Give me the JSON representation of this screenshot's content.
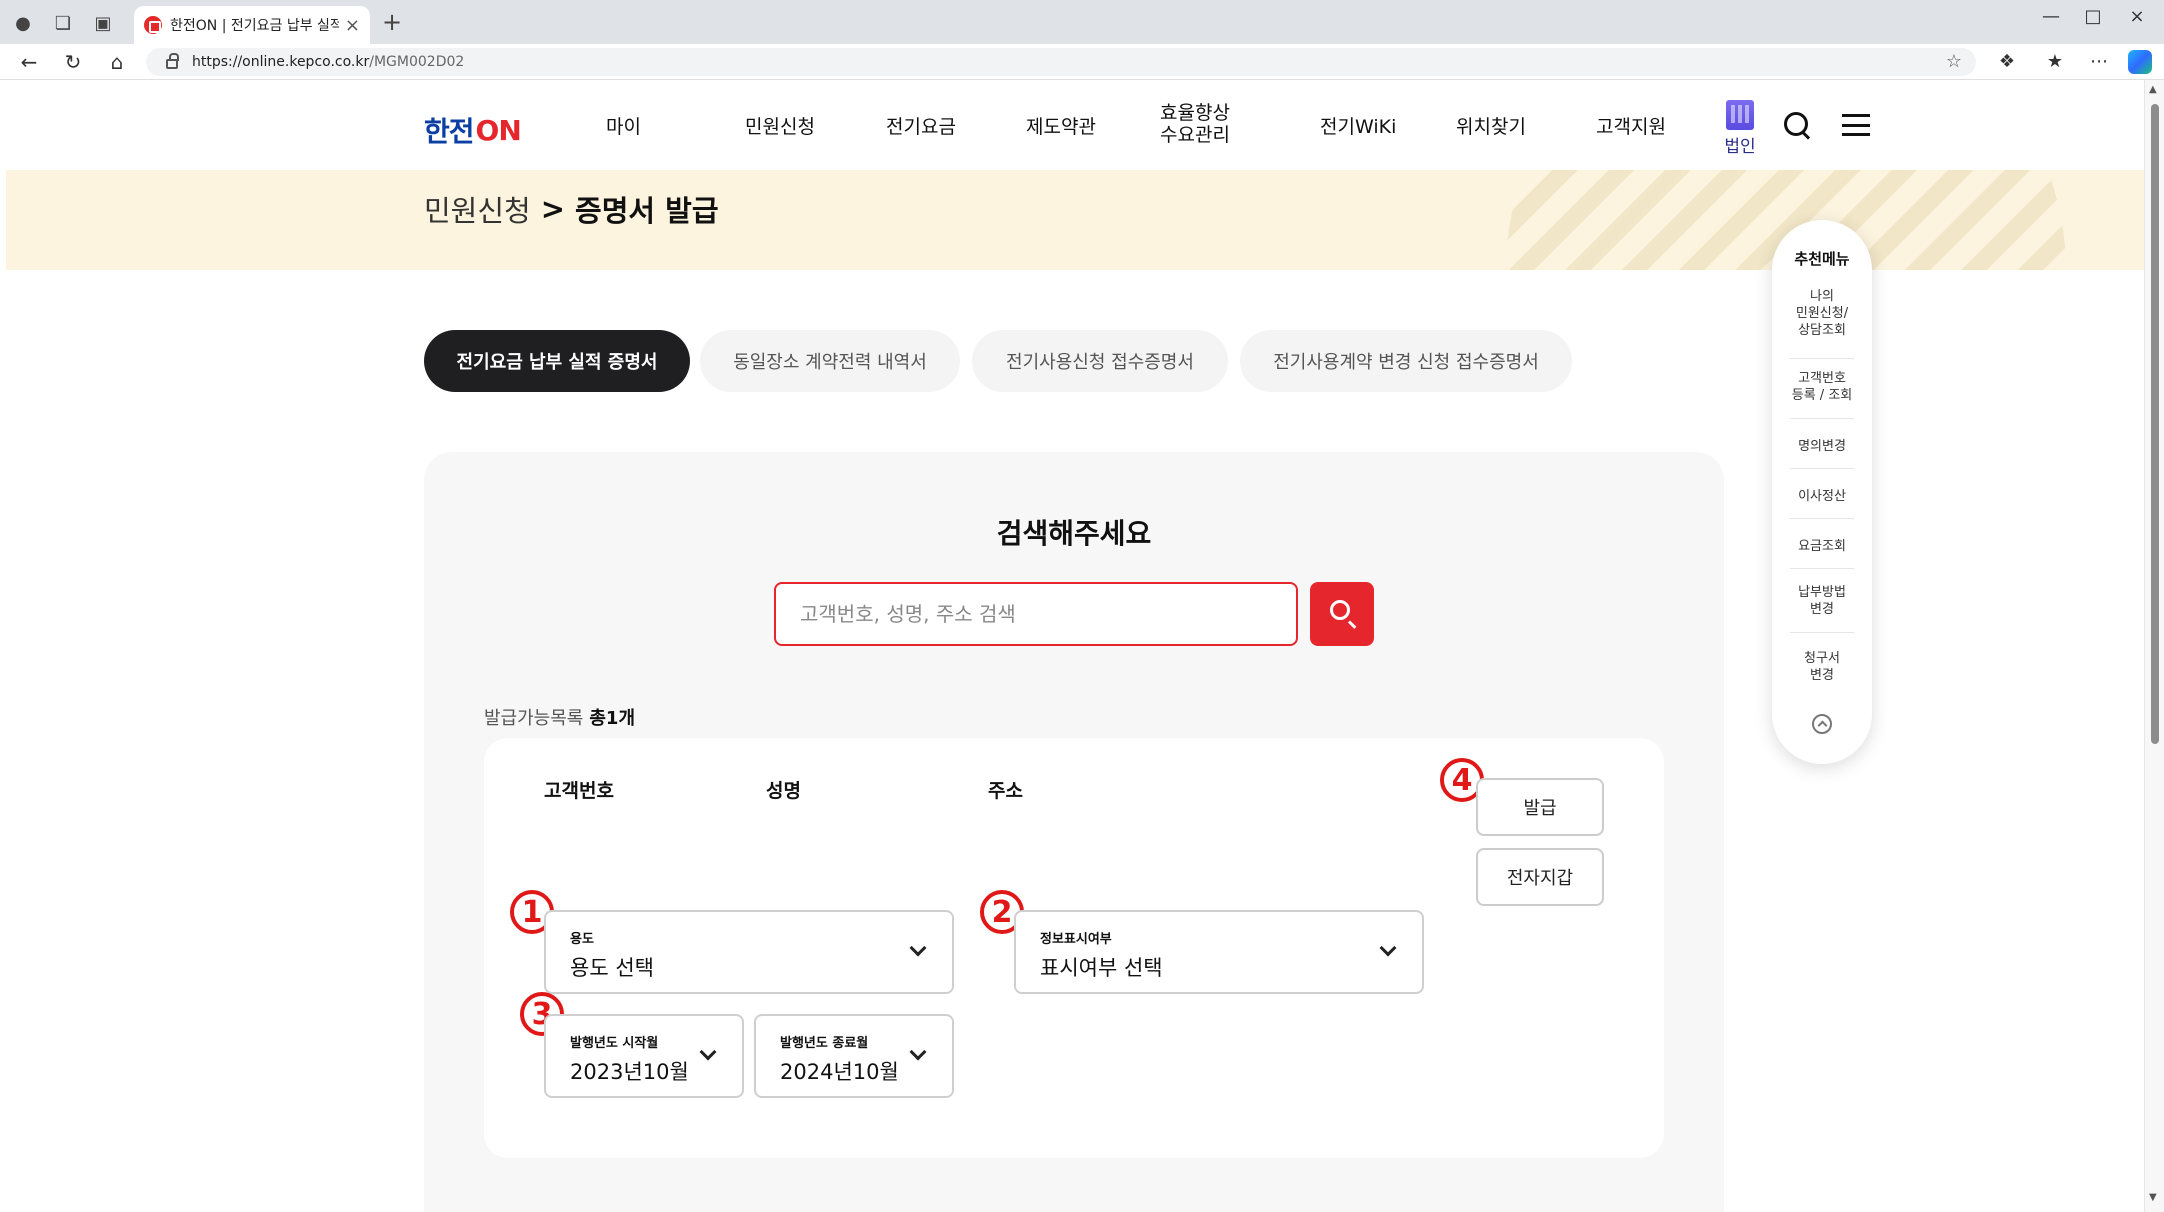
{
  "browser": {
    "tab_title": "한전ON | 전기요금 납부 실적 증명",
    "url_host": "https://online.kepco.co.kr",
    "url_path": "/MGM002D02"
  },
  "header": {
    "logo_han": "한전",
    "logo_on": "ON",
    "nav": [
      "마이",
      "민원신청",
      "전기요금",
      "제도약관",
      "효율향상\n수요관리",
      "전기WiKi",
      "위치찾기",
      "고객지원"
    ],
    "nav_efficiency_line1": "효율향상",
    "nav_efficiency_line2": "수요관리",
    "corp_label": "법인"
  },
  "breadcrumb": {
    "parent": "민원신청",
    "separator": ">",
    "current": "증명서 발급"
  },
  "tabs": [
    {
      "label": "전기요금 납부 실적 증명서",
      "active": true
    },
    {
      "label": "동일장소 계약전력 내역서",
      "active": false
    },
    {
      "label": "전기사용신청 접수증명서",
      "active": false
    },
    {
      "label": "전기사용계약 변경 신청 접수증명서",
      "active": false
    }
  ],
  "search": {
    "title": "검색해주세요",
    "placeholder": "고객번호, 성명, 주소 검색"
  },
  "list": {
    "label": "발급가능목록",
    "count": "총1개",
    "columns": [
      "고객번호",
      "성명",
      "주소"
    ]
  },
  "buttons": {
    "issue": "발급",
    "wallet": "전자지갑"
  },
  "form": {
    "purpose": {
      "label": "용도",
      "value": "용도 선택"
    },
    "info_display": {
      "label": "정보표시여부",
      "value": "표시여부 선택"
    },
    "start_month": {
      "label": "발행년도 시작월",
      "value": "2023년10월"
    },
    "end_month": {
      "label": "발행년도 종료월",
      "value": "2024년10월"
    }
  },
  "markers": [
    "1",
    "2",
    "3",
    "4"
  ],
  "float_menu": {
    "title": "추천메뉴",
    "items": [
      "나의\n민원신청/\n상담조회",
      "고객번호\n등록 / 조회",
      "명의변경",
      "이사정산",
      "요금조회",
      "납부방법\n변경",
      "청구서\n변경"
    ]
  },
  "colors": {
    "brand_red": "#e5262d",
    "brand_blue": "#0b3fa3",
    "band_bg": "#fcf4de",
    "active_tab": "#1f1f22"
  }
}
